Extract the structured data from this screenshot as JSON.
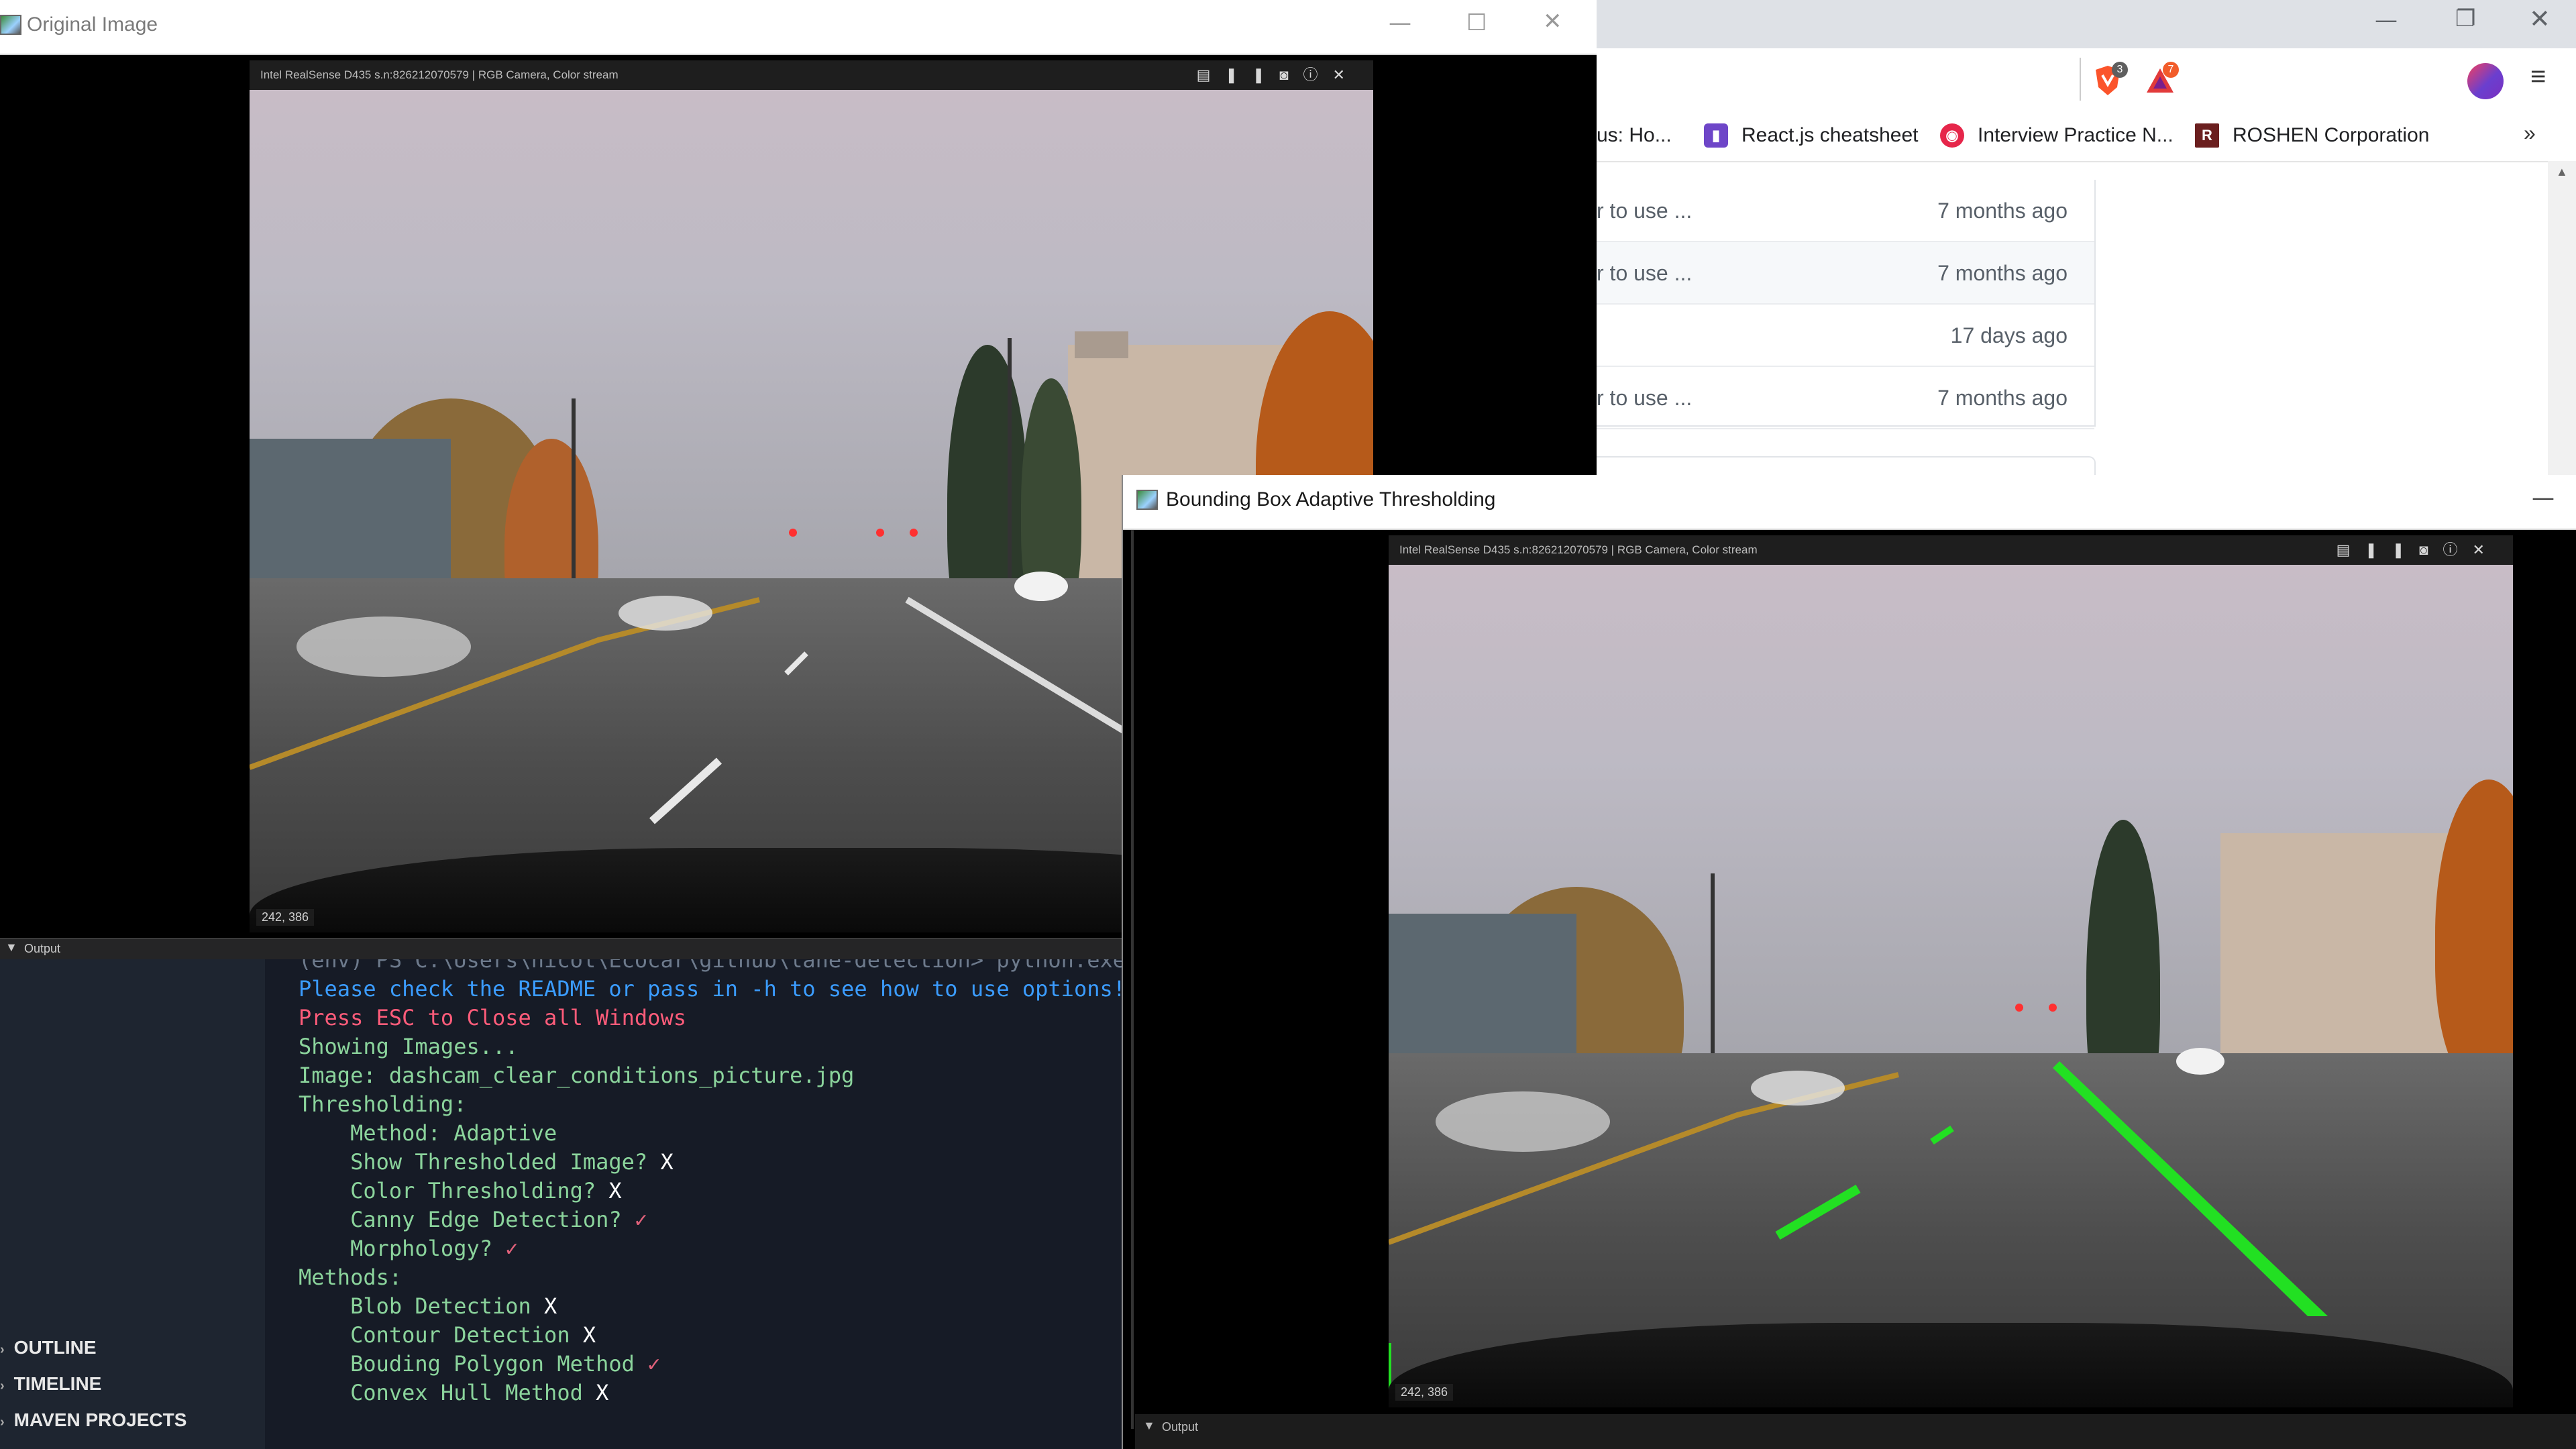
{
  "browser": {
    "badges": {
      "brave": "3",
      "bat": "7"
    },
    "bookmarks": [
      {
        "label": "us: Ho...",
        "icon": "bookmark-icon"
      },
      {
        "label": "React.js cheatsheet",
        "icon": "bookmark-icon"
      },
      {
        "label": "Interview Practice N...",
        "icon": "bookmark-icon"
      },
      {
        "label": "ROSHEN Corporation",
        "icon": "R"
      }
    ],
    "overflow": "»",
    "files": [
      {
        "msg": "r to use ...",
        "age": "7 months ago"
      },
      {
        "msg": "r to use ...",
        "age": "7 months ago"
      },
      {
        "msg": "",
        "age": "17 days ago"
      },
      {
        "msg": "r to use ...",
        "age": "7 months ago"
      }
    ]
  },
  "orig_window": {
    "title": "Original Image",
    "camera_bar": "Intel RealSense D435 s.n:826212070579 | RGB Camera, Color stream",
    "coord": "242, 386"
  },
  "output": {
    "header": "Output",
    "sidebar": [
      "OUTLINE",
      "TIMELINE",
      "MAVEN PROJECTS"
    ],
    "lines": [
      {
        "text": "(env) PS C:\\Users\\nicol\\Ecocar\\github\\lane-detection> python.exe",
        "cls": "grey"
      },
      {
        "text": "Please check the README or pass in -h to see how to use options!",
        "cls": "blue"
      },
      {
        "text": "Press ESC to Close all Windows",
        "cls": "red"
      },
      {
        "text": "",
        "cls": "green"
      },
      {
        "text": "Showing Images...",
        "cls": "green"
      },
      {
        "text": "Image: dashcam_clear_conditions_picture.jpg",
        "cls": "green"
      },
      {
        "text": "Thresholding:",
        "cls": "green"
      },
      {
        "text": "    Method: Adaptive",
        "cls": "green"
      },
      {
        "text": "    Show Thresholded Image?",
        "cls": "green",
        "mark": "X"
      },
      {
        "text": "    Color Thresholding?",
        "cls": "green",
        "mark": "X"
      },
      {
        "text": "    Canny Edge Detection?",
        "cls": "green",
        "mark": "✓"
      },
      {
        "text": "    Morphology?",
        "cls": "green",
        "mark": "✓"
      },
      {
        "text": "Methods:",
        "cls": "green"
      },
      {
        "text": "    Blob Detection",
        "cls": "green",
        "mark": "X"
      },
      {
        "text": "    Contour Detection",
        "cls": "green",
        "mark": "X"
      },
      {
        "text": "    Bouding Polygon Method",
        "cls": "green",
        "mark": "✓"
      },
      {
        "text": "    Convex Hull Method",
        "cls": "green",
        "mark": "X"
      }
    ]
  },
  "bbox_window": {
    "title": "Bounding Box Adaptive Thresholding",
    "camera_bar": "Intel RealSense D435 s.n:826212070579 | RGB Camera, Color stream",
    "coord": "242, 386",
    "output_label": "Output"
  },
  "colors": {
    "lane_overlay": "#22e022",
    "terminal_bg": "#161b26"
  }
}
